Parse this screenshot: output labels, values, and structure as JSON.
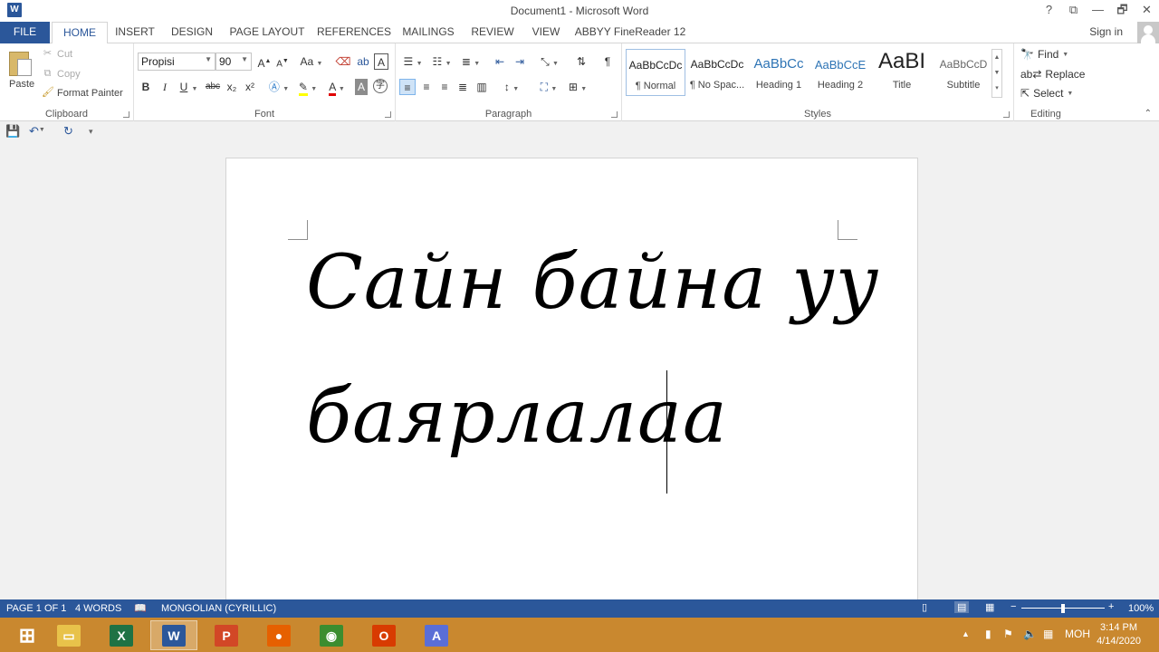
{
  "window": {
    "title": "Document1 - Microsoft Word",
    "app_icon_letter": "W",
    "help": "?",
    "ribbon_options": "⧉",
    "minimize": "—",
    "restore": "🗗",
    "close": "✕"
  },
  "tabs": {
    "file": "FILE",
    "items": [
      "HOME",
      "INSERT",
      "DESIGN",
      "PAGE LAYOUT",
      "REFERENCES",
      "MAILINGS",
      "REVIEW",
      "VIEW",
      "ABBYY FineReader 12"
    ],
    "active": "HOME",
    "sign_in": "Sign in"
  },
  "clipboard": {
    "paste": "Paste",
    "cut": "Cut",
    "copy": "Copy",
    "format_painter": "Format Painter",
    "label": "Clipboard"
  },
  "font": {
    "name": "Propisi",
    "size": "90",
    "grow": "A",
    "shrink": "A",
    "change_case": "Aa",
    "bold": "B",
    "italic": "I",
    "underline": "U",
    "strikethrough": "abc",
    "subscript": "x₂",
    "superscript": "x²",
    "font_color": "A",
    "shading": "A",
    "label": "Font"
  },
  "paragraph": {
    "pilcrow": "¶",
    "label": "Paragraph"
  },
  "styles": {
    "items": [
      {
        "sample": "AaBbCcDc",
        "name": "¶ Normal"
      },
      {
        "sample": "AaBbCcDc",
        "name": "¶ No Spac..."
      },
      {
        "sample": "AaBbCc",
        "name": "Heading 1"
      },
      {
        "sample": "AaBbCcE",
        "name": "Heading 2"
      },
      {
        "sample": "AaBI",
        "name": "Title"
      },
      {
        "sample": "AaBbCcD",
        "name": "Subtitle"
      }
    ],
    "label": "Styles"
  },
  "editing": {
    "find": "Find",
    "replace": "Replace",
    "select": "Select",
    "label": "Editing"
  },
  "document": {
    "line1": "Сайн байна уу",
    "line2": "баярлалаа"
  },
  "status": {
    "page": "PAGE 1 OF 1",
    "words": "4 WORDS",
    "language": "MONGOLIAN (CYRILLIC)",
    "zoom_minus": "−",
    "zoom_plus": "+",
    "zoom": "100%",
    "zoom_fraction": 0.5
  },
  "taskbar": {
    "apps": [
      {
        "name": "start",
        "glyph": "⊞",
        "color": "#ffffff"
      },
      {
        "name": "file-explorer",
        "glyph": "▭",
        "color": "#e8c24a"
      },
      {
        "name": "excel",
        "glyph": "X",
        "color": "#1f7244"
      },
      {
        "name": "word",
        "glyph": "W",
        "color": "#2b579a"
      },
      {
        "name": "powerpoint",
        "glyph": "P",
        "color": "#d24726"
      },
      {
        "name": "firefox",
        "glyph": "●",
        "color": "#e66000"
      },
      {
        "name": "chrome",
        "glyph": "◉",
        "color": "#3c8d2f"
      },
      {
        "name": "office",
        "glyph": "O",
        "color": "#d83b01"
      },
      {
        "name": "abbyy",
        "glyph": "A",
        "color": "#5a6ed6"
      }
    ],
    "language": "MOH",
    "time": "3:14 PM",
    "date": "4/14/2020"
  }
}
